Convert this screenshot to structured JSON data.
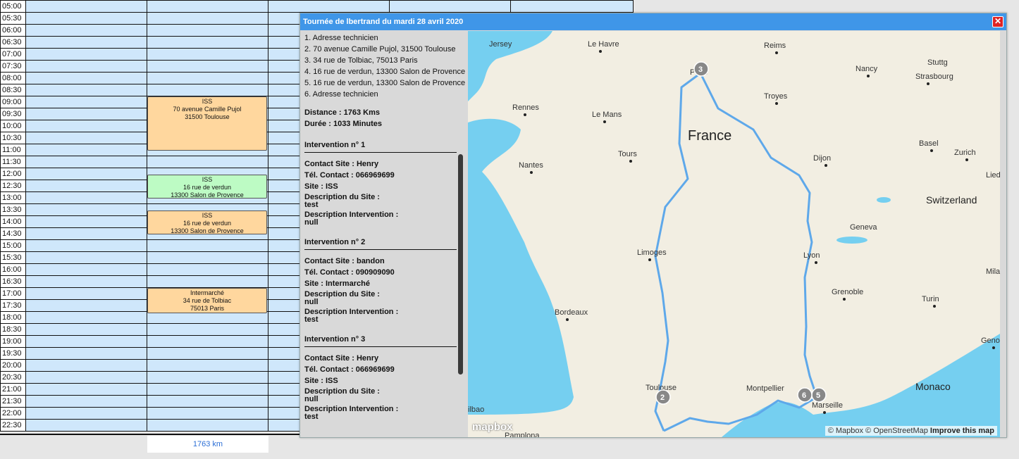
{
  "schedule": {
    "times": [
      "05:00",
      "05:30",
      "06:00",
      "06:30",
      "07:00",
      "07:30",
      "08:00",
      "08:30",
      "09:00",
      "09:30",
      "10:00",
      "10:30",
      "11:00",
      "11:30",
      "12:00",
      "12:30",
      "13:00",
      "13:30",
      "14:00",
      "14:30",
      "15:00",
      "15:30",
      "16:00",
      "16:30",
      "17:00",
      "17:30",
      "18:00",
      "18:30",
      "19:00",
      "19:30",
      "20:00",
      "20:30",
      "21:00",
      "21:30",
      "22:00",
      "22:30"
    ],
    "events": [
      {
        "site": "ISS",
        "line1": "70 avenue Camille Pujol",
        "line2": "31500 Toulouse"
      },
      {
        "site": "ISS",
        "line1": "16 rue de verdun",
        "line2": "13300 Salon de Provence"
      },
      {
        "site": "ISS",
        "line1": "16 rue de verdun",
        "line2": "13300 Salon de Provence"
      },
      {
        "site": "Intermarché",
        "line1": "34 rue de Tolbiac",
        "line2": "75013 Paris"
      }
    ],
    "total_km": "1763 km"
  },
  "dialog": {
    "title": "Tournée de lbertrand du mardi 28 avril 2020",
    "close_label": "✕",
    "stops": [
      "1. Adresse technicien",
      "2. 70 avenue Camille Pujol, 31500 Toulouse",
      "3. 34 rue de Tolbiac, 75013 Paris",
      "4. 16 rue de verdun, 13300 Salon de Provence",
      "5. 16 rue de verdun, 13300 Salon de Provence",
      "6. Adresse technicien"
    ],
    "distance": "Distance : 1763 Kms",
    "duration": "Durée : 1033 Minutes",
    "labels": {
      "contact": "Contact Site :",
      "tel": "Tél. Contact :",
      "site": "Site :",
      "description_site": "Description du Site :",
      "description_intervention": "Description Intervention :"
    },
    "interventions": [
      {
        "title": "Intervention n° 1",
        "contact": "Henry",
        "tel": "066969699",
        "site": "ISS",
        "desc_site": "test",
        "desc_intervention": "null"
      },
      {
        "title": "Intervention n° 2",
        "contact": "bandon",
        "tel": "090909090",
        "site": "Intermarché",
        "desc_site": "null",
        "desc_intervention": "test"
      },
      {
        "title": "Intervention n° 3",
        "contact": "Henry",
        "tel": "066969699",
        "site": "ISS",
        "desc_site": "null",
        "desc_intervention": "test"
      }
    ]
  },
  "map": {
    "cities": [
      "Le Havre",
      "Reims",
      "Jersey",
      "Paris",
      "Nancy",
      "Stuttg",
      "Strasbourg",
      "Rennes",
      "Le Mans",
      "Troyes",
      "Tours",
      "Dijon",
      "Basel",
      "Zurich",
      "Nantes",
      "Lied",
      "Switzerland",
      "Geneva",
      "Limoges",
      "Lyon",
      "Mila",
      "Grenoble",
      "Turin",
      "Bordeaux",
      "Genoa",
      "Montpellier",
      "Toulouse",
      "Monaco",
      "Marseille",
      "ilbao",
      "Pamplona"
    ],
    "country_label": "France",
    "markers": [
      "2",
      "3",
      "5",
      "6"
    ],
    "logo": "mapbox",
    "attribution": "© Mapbox © OpenStreetMap",
    "improve": "Improve this map",
    "colors": {
      "route": "#5ea8ea",
      "water": "#75cff0",
      "land": "#f2eee2"
    }
  }
}
